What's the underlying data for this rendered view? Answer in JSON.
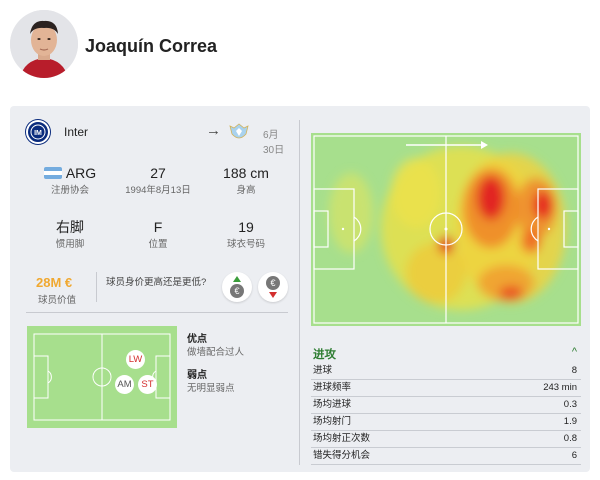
{
  "player": {
    "name": "Joaquín Correa"
  },
  "club": {
    "name": "Inter",
    "transfer_date": "6月30日"
  },
  "stats": {
    "nationality": {
      "value": "ARG",
      "label": "注册协会"
    },
    "age": {
      "value": "27",
      "label": "1994年8月13日"
    },
    "height": {
      "value": "188 cm",
      "label": "身高"
    },
    "foot": {
      "value": "右脚",
      "label": "惯用脚"
    },
    "position": {
      "value": "F",
      "label": "位置"
    },
    "shirt": {
      "value": "19",
      "label": "球衣号码"
    }
  },
  "market": {
    "value": "28M €",
    "label": "球员价值",
    "question": "球员身价更高还是更低?"
  },
  "positions": {
    "primary": "LW",
    "secondary": [
      "AM",
      "ST"
    ]
  },
  "strengths": {
    "title": "优点",
    "text": "做墙配合过人"
  },
  "weaknesses": {
    "title": "弱点",
    "text": "无明显弱点"
  },
  "attack": {
    "title": "进攻",
    "rows": [
      {
        "label": "进球",
        "value": "8"
      },
      {
        "label": "进球频率",
        "value": "243 min"
      },
      {
        "label": "场均进球",
        "value": "0.3"
      },
      {
        "label": "场均射门",
        "value": "1.9"
      },
      {
        "label": "场均射正次数",
        "value": "0.8"
      },
      {
        "label": "错失得分机会",
        "value": "6"
      }
    ]
  },
  "colors": {
    "pitch": "#a7df8d",
    "market_value": "#f0a830",
    "section_accent": "#2e7d32",
    "vote_up": "#3a9d3a",
    "vote_down": "#d32f2f"
  },
  "icons": [
    "avatar-photo",
    "inter-logo",
    "arrow-right-icon",
    "lazio-logo",
    "argentina-flag-icon",
    "vote-up-icon",
    "vote-down-icon",
    "chevron-up-icon"
  ]
}
